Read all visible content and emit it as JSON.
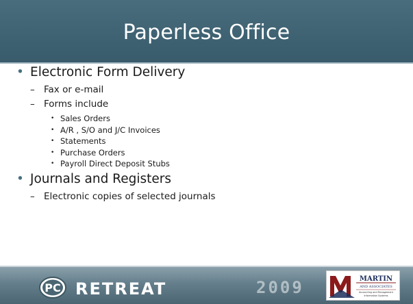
{
  "slide": {
    "title": "Paperless Office",
    "bullets": [
      {
        "level": 1,
        "text": "Electronic Form Delivery"
      },
      {
        "level": 2,
        "text": "Fax or e-mail"
      },
      {
        "level": 2,
        "text": "Forms include"
      },
      {
        "level": 3,
        "text": "Sales Orders"
      },
      {
        "level": 3,
        "text": "A/R , S/O and J/C Invoices"
      },
      {
        "level": 3,
        "text": "Statements"
      },
      {
        "level": 3,
        "text": "Purchase Orders"
      },
      {
        "level": 3,
        "text": "Payroll Direct Deposit Stubs"
      },
      {
        "level": 1,
        "text": "Journals and Registers"
      },
      {
        "level": 2,
        "text": "Electronic copies of selected journals"
      }
    ]
  },
  "footer": {
    "pc_logo_text": "PC",
    "retreat_text": "RETREAT",
    "year": "2009",
    "sponsor_logo": {
      "name": "MARTIN",
      "subtitle": "AND ASSOCIATES",
      "tagline_1": "Accounting and Management",
      "tagline_2": "Information Systems"
    }
  },
  "colors": {
    "title_bar": "#416575",
    "bullet_accent": "#47707f",
    "footer": "#647e8b",
    "martin_red": "#8b1a1a"
  }
}
